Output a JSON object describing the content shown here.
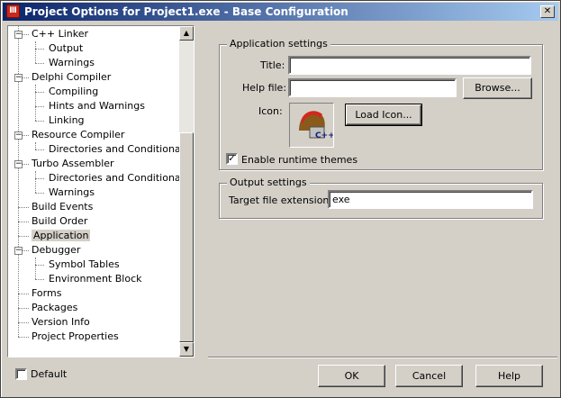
{
  "window": {
    "title": "Project Options for Project1.exe - Base Configuration",
    "close_glyph": "✕",
    "app_icon_glyph": "Ⅲ"
  },
  "tree": {
    "nodes": [
      {
        "label": "C++ Linker",
        "level": 0,
        "expander": "−"
      },
      {
        "label": "Output",
        "level": 1
      },
      {
        "label": "Warnings",
        "level": 1
      },
      {
        "label": "Delphi Compiler",
        "level": 0,
        "expander": "−"
      },
      {
        "label": "Compiling",
        "level": 1
      },
      {
        "label": "Hints and Warnings",
        "level": 1
      },
      {
        "label": "Linking",
        "level": 1
      },
      {
        "label": "Resource Compiler",
        "level": 0,
        "expander": "−"
      },
      {
        "label": "Directories and Conditionals",
        "level": 1
      },
      {
        "label": "Turbo Assembler",
        "level": 0,
        "expander": "−"
      },
      {
        "label": "Directories and Conditionals",
        "level": 1
      },
      {
        "label": "Warnings",
        "level": 1
      },
      {
        "label": "Build Events",
        "level": 0
      },
      {
        "label": "Build Order",
        "level": 0
      },
      {
        "label": "Application",
        "level": 0,
        "selected": true
      },
      {
        "label": "Debugger",
        "level": 0,
        "expander": "−"
      },
      {
        "label": "Symbol Tables",
        "level": 1
      },
      {
        "label": "Environment Block",
        "level": 1
      },
      {
        "label": "Forms",
        "level": 0
      },
      {
        "label": "Packages",
        "level": 0
      },
      {
        "label": "Version Info",
        "level": 0
      },
      {
        "label": "Project Properties",
        "level": 0
      }
    ],
    "scroll_up_glyph": "▲",
    "scroll_down_glyph": "▼"
  },
  "app_settings": {
    "group_title": "Application settings",
    "title_label": "Title:",
    "title_value": "",
    "helpfile_label": "Help file:",
    "helpfile_value": "",
    "browse_label": "Browse...",
    "icon_label": "Icon:",
    "load_icon_label": "Load Icon...",
    "themes_label": "Enable runtime themes",
    "themes_checked": true,
    "check_glyph": "✓",
    "icon_glyph": "C++"
  },
  "output_settings": {
    "group_title": "Output settings",
    "ext_label": "Target file extension:",
    "ext_value": "exe"
  },
  "footer": {
    "default_label": "Default",
    "default_checked": false,
    "ok_label": "OK",
    "cancel_label": "Cancel",
    "help_label": "Help"
  }
}
